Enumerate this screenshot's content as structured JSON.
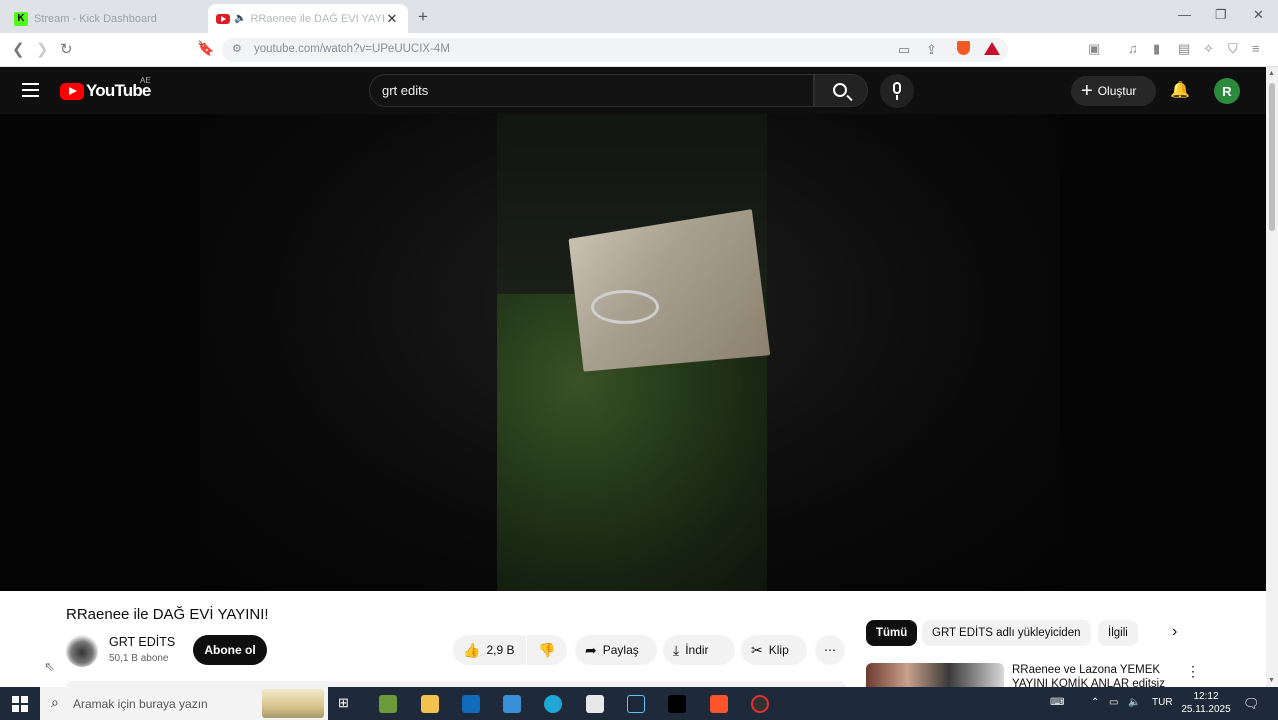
{
  "browser": {
    "tabs": [
      {
        "title": "Stream - Kick Dashboard",
        "active": false
      },
      {
        "title": "RRaenee ile DAĞ EVİ YAYINI",
        "active": true
      }
    ],
    "url": "youtube.com/watch?v=UPeUUCIX-4M"
  },
  "youtube": {
    "logo_text": "YouTube",
    "country": "AE",
    "search_value": "grt edits",
    "create_label": "Oluştur",
    "avatar_letter": "R",
    "accent_color": "#ff0000"
  },
  "video": {
    "title": "RRaenee ile DAĞ EVİ YAYINI!",
    "channel_name": "GRT EDİTS",
    "channel_subs": "50,1 B abone",
    "subscribe_label": "Abone ol",
    "like_count": "2,9 B",
    "share_label": "Paylaş",
    "download_label": "İndir",
    "clip_label": "Klip"
  },
  "sidebar": {
    "chips": [
      "Tümü",
      "GRT EDİTS adlı yükleyiciden",
      "İlgili"
    ],
    "suggested": [
      {
        "title": "RRaenee ve Lazona YEMEK YAYINI KOMİK ANLAR editsiz"
      }
    ]
  },
  "taskbar": {
    "search_placeholder": "Aramak için buraya yazın",
    "language": "TUR",
    "time": "12:12",
    "date": "25.11.2025"
  }
}
